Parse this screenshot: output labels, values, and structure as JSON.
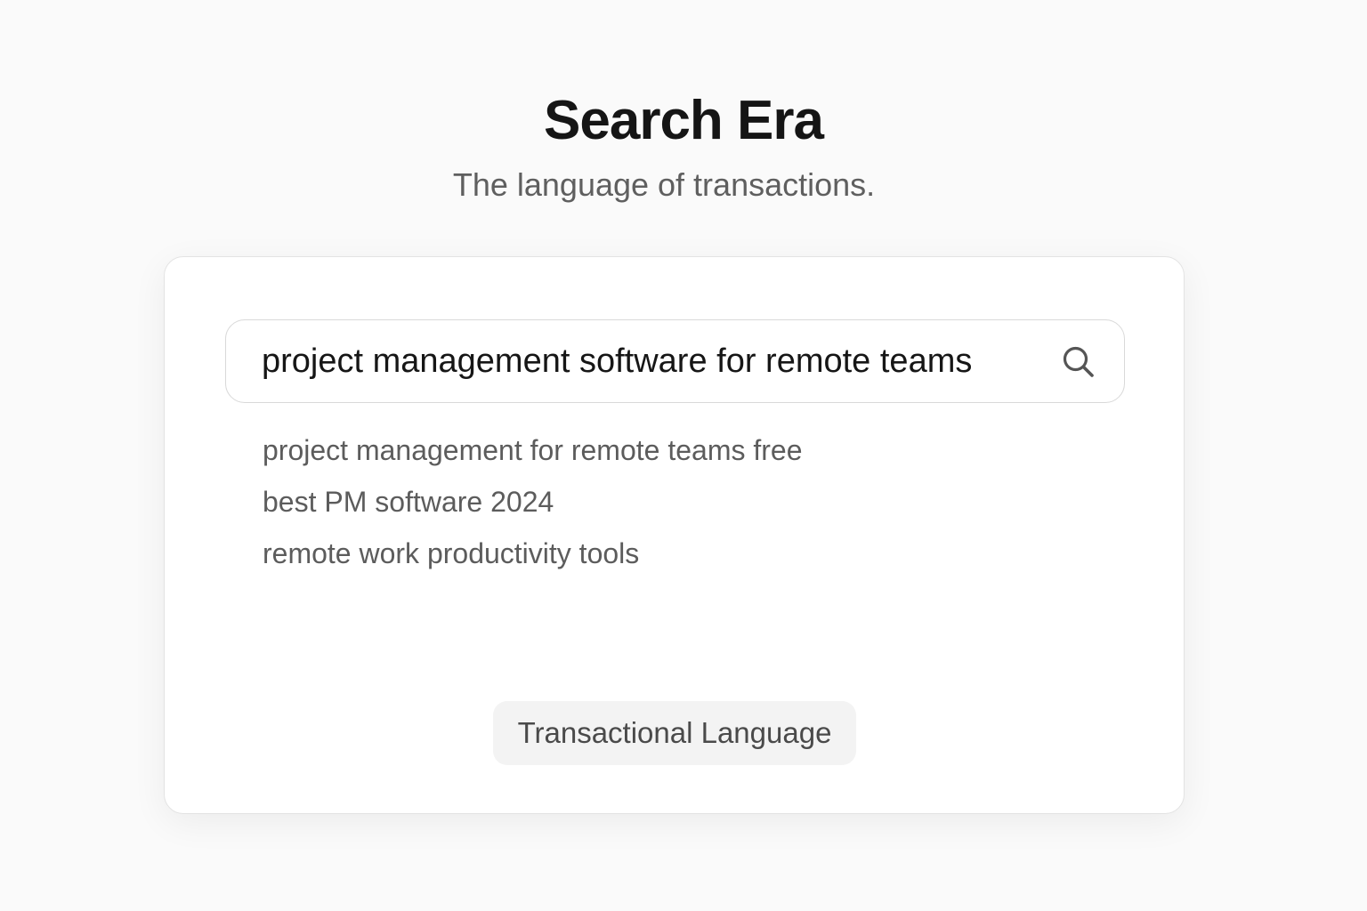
{
  "header": {
    "title": "Search Era",
    "subtitle": "The language of transactions."
  },
  "search": {
    "value": "project management software for remote teams",
    "icon": "search-icon"
  },
  "suggestions": [
    {
      "label": "project management for remote teams free"
    },
    {
      "label": "best PM software 2024"
    },
    {
      "label": "remote work productivity tools"
    }
  ],
  "tag": {
    "label": "Transactional Language"
  },
  "colors": {
    "background": "#fafafa",
    "card": "#ffffff",
    "border": "#e3e3e3",
    "title": "#151515",
    "muted_text": "#5f5f5f",
    "tag_background": "#f3f3f3"
  }
}
